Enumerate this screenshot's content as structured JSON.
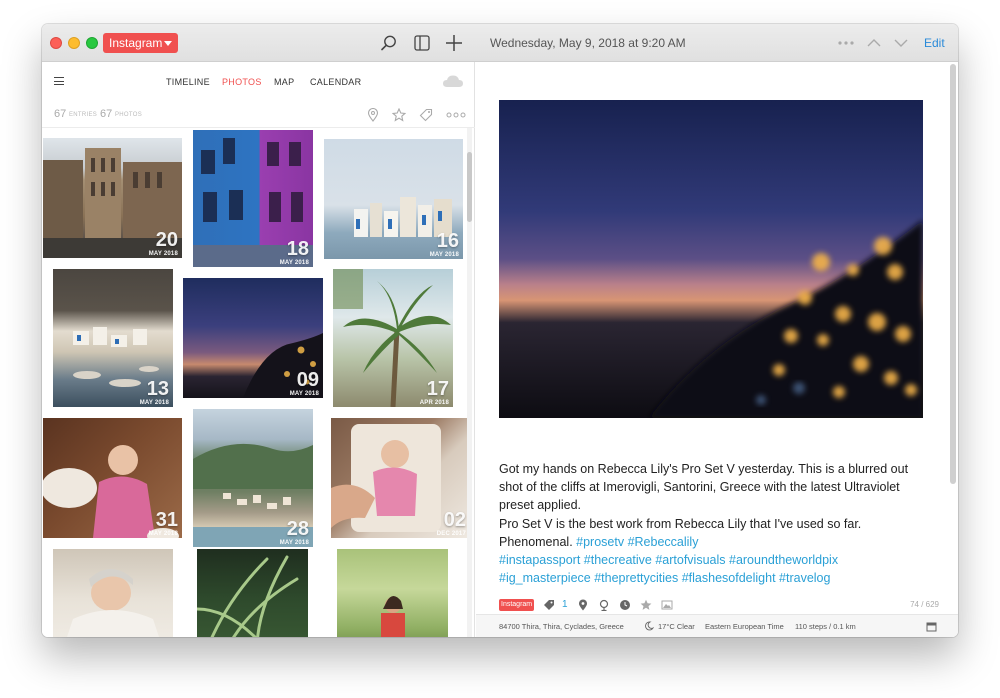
{
  "titlebar": {
    "journal": "Instagram",
    "date": "Wednesday, May 9, 2018 at 9:20 AM",
    "edit": "Edit"
  },
  "nav": {
    "tabs": [
      "TIMELINE",
      "PHOTOS",
      "MAP",
      "CALENDAR"
    ],
    "active": "PHOTOS"
  },
  "stats": {
    "entries_count": "67",
    "entries_label": "ENTRIES",
    "photos_count": "67",
    "photos_label": "PHOTOS"
  },
  "photos": [
    {
      "day": "20",
      "month": "MAY 2018"
    },
    {
      "day": "18",
      "month": "MAY 2018"
    },
    {
      "day": "16",
      "month": "MAY 2018"
    },
    {
      "day": "13",
      "month": "MAY 2018"
    },
    {
      "day": "09",
      "month": "MAY 2018"
    },
    {
      "day": "17",
      "month": "APR 2018"
    },
    {
      "day": "31",
      "month": "MAY 2018"
    },
    {
      "day": "28",
      "month": "MAY 2018"
    },
    {
      "day": "02",
      "month": "DEC 2017"
    }
  ],
  "entry": {
    "text": "Got my hands on Rebecca Lily's Pro Set V yesterday. This is a blurred out shot of the cliffs at Imerovigli, Santorini, Greece with the latest Ultraviolet preset applied.",
    "text2": "Pro Set V is the best work from Rebecca Lily that I've used so far. Phenomenal.",
    "tags_inline": "#prosetv #Rebeccalily",
    "tags_line1": "#instapassport #thecreative #artofvisuals #aroundtheworldpix",
    "tags_line2": "#ig_masterpiece #theprettycities #flashesofdelight #travelog"
  },
  "meta": {
    "journal_badge": "Instagram",
    "tag_count": "1",
    "word_count": "74  /  629"
  },
  "footer": {
    "location": "84700 Thira, Thira, Cyclades, Greece",
    "weather": "17°C Clear",
    "timezone": "Eastern European Time",
    "steps": "110 steps / 0.1 km"
  },
  "colors": {
    "accent": "#f0504f",
    "link": "#2aa0d6",
    "edit": "#2a8ad8"
  }
}
